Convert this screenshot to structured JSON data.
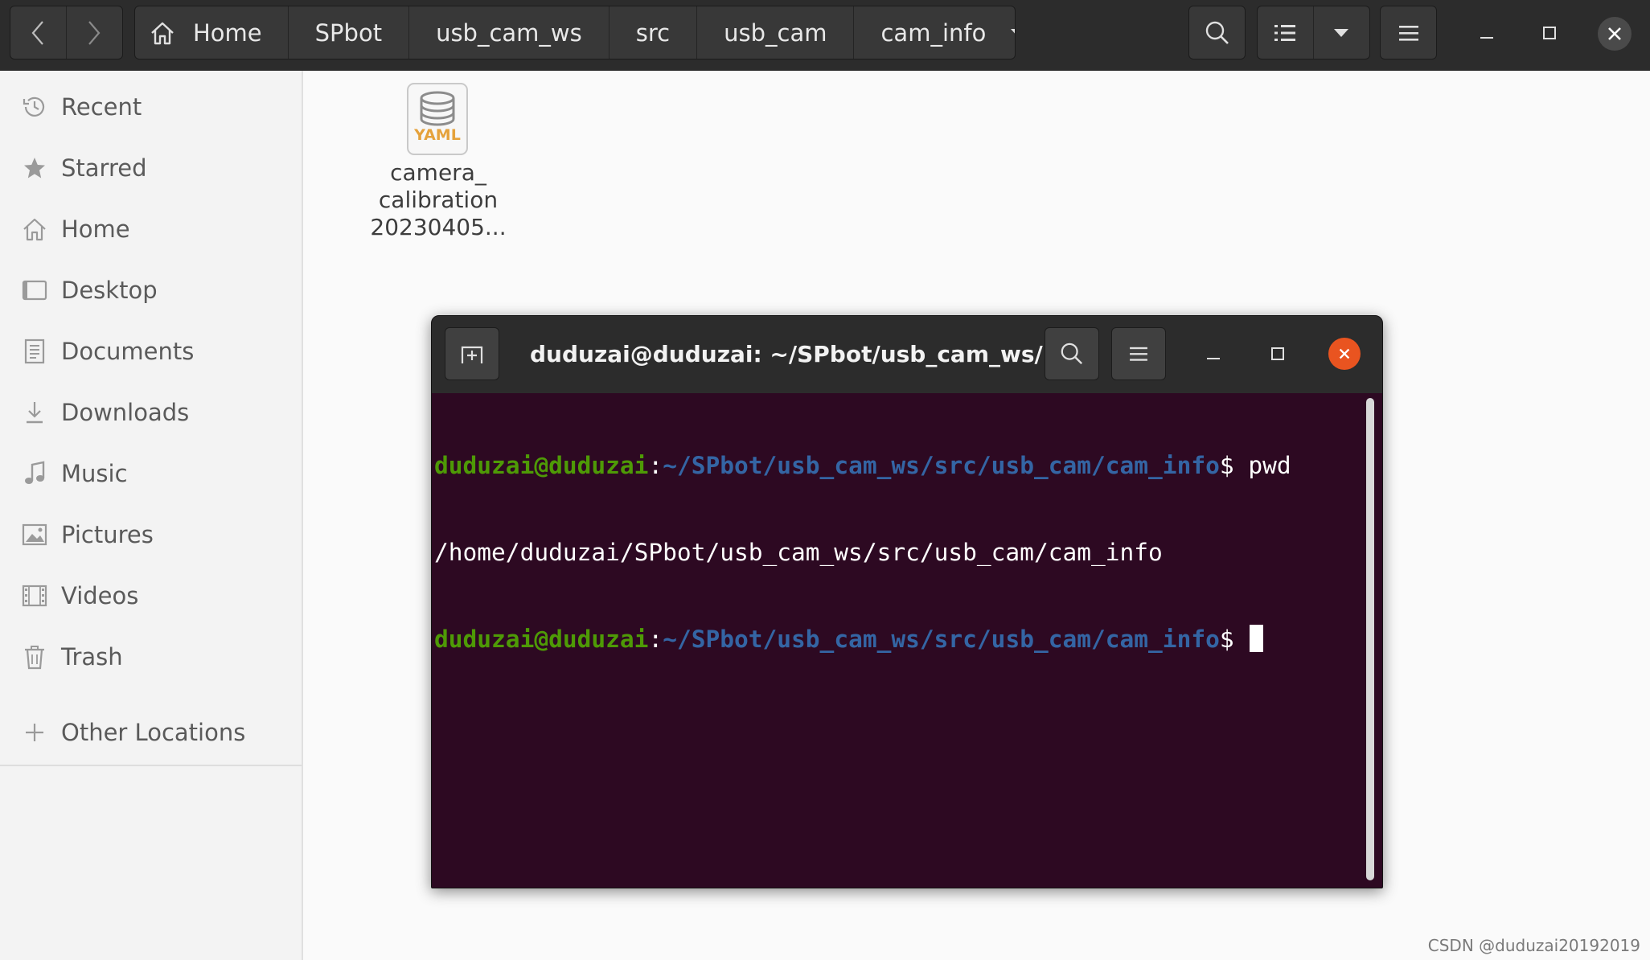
{
  "header": {
    "breadcrumbs": [
      "Home",
      "SPbot",
      "usb_cam_ws",
      "src",
      "usb_cam",
      "cam_info"
    ],
    "icons": {
      "back": "chevron-left-icon",
      "forward": "chevron-right-icon",
      "home": "home-icon",
      "dropdown": "triangle-down-icon",
      "search": "search-icon",
      "list_view": "list-view-icon",
      "view_options": "triangle-down-icon",
      "menu": "hamburger-menu-icon",
      "minimize": "minimize-icon",
      "maximize": "maximize-icon",
      "close": "close-icon"
    }
  },
  "sidebar": {
    "items": [
      {
        "label": "Recent",
        "icon": "clock-icon"
      },
      {
        "label": "Starred",
        "icon": "star-icon"
      },
      {
        "label": "Home",
        "icon": "home-icon"
      },
      {
        "label": "Desktop",
        "icon": "desktop-icon"
      },
      {
        "label": "Documents",
        "icon": "document-icon"
      },
      {
        "label": "Downloads",
        "icon": "download-icon"
      },
      {
        "label": "Music",
        "icon": "music-icon"
      },
      {
        "label": "Pictures",
        "icon": "picture-icon"
      },
      {
        "label": "Videos",
        "icon": "video-icon"
      },
      {
        "label": "Trash",
        "icon": "trash-icon"
      }
    ],
    "other_locations": {
      "label": "Other Locations",
      "icon": "plus-icon"
    }
  },
  "files": [
    {
      "name_lines": [
        "camera_",
        "calibration",
        "20230405..."
      ],
      "icon": "yaml-file-icon",
      "badge": "YAML"
    }
  ],
  "terminal": {
    "title": "duduzai@duduzai: ~/SPbot/usb_cam_ws/...",
    "lines": [
      {
        "user": "duduzai@duduzai",
        "sep": ":",
        "path": "~/SPbot/usb_cam_ws/src/usb_cam/cam_info",
        "prompt": "$ ",
        "cmd": "pwd"
      },
      {
        "output": "/home/duduzai/SPbot/usb_cam_ws/src/usb_cam/cam_info"
      },
      {
        "user": "duduzai@duduzai",
        "sep": ":",
        "path": "~/SPbot/usb_cam_ws/src/usb_cam/cam_info",
        "prompt": "$ ",
        "cmd": ""
      }
    ],
    "colors": {
      "background": "#2d0922",
      "user": "#4e9a06",
      "path": "#3465a4",
      "close": "#e95420"
    }
  },
  "watermark": "CSDN @duduzai20192019"
}
